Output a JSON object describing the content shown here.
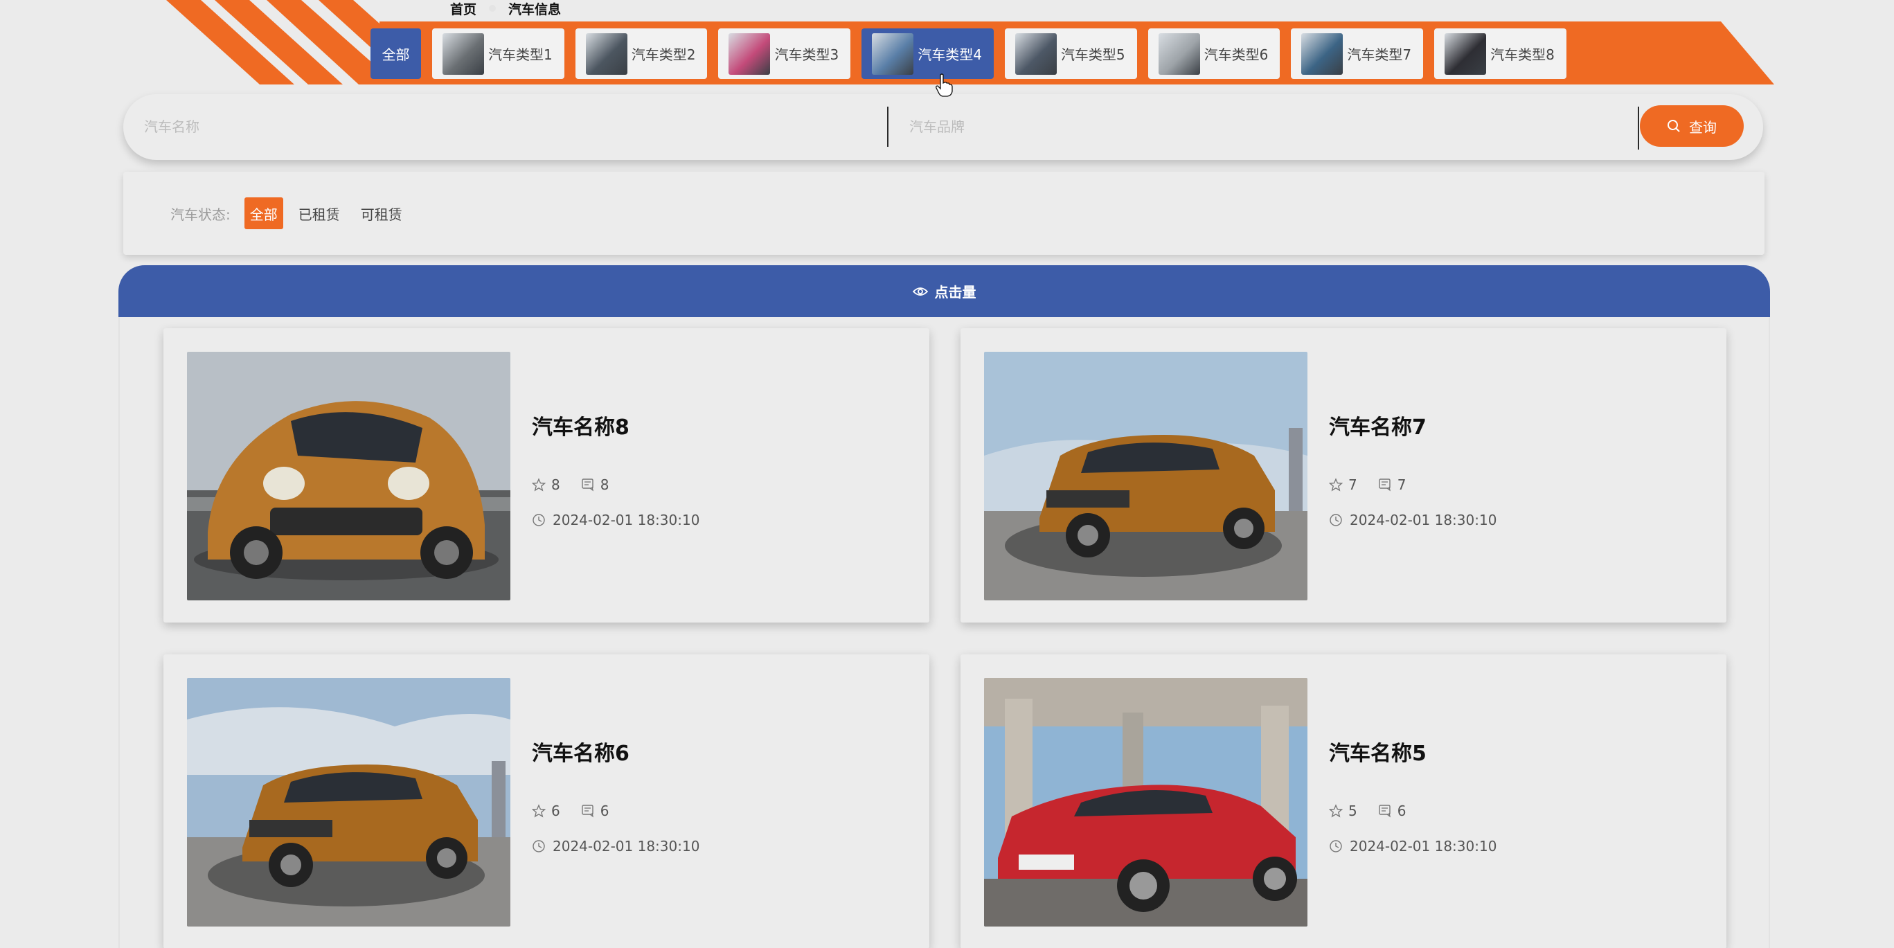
{
  "breadcrumb": {
    "home": "首页",
    "current": "汽车信息"
  },
  "categories": {
    "all_label": "全部",
    "items": [
      {
        "label": "汽车类型1",
        "color": "#6a6f73"
      },
      {
        "label": "汽车类型2",
        "color": "#4c5660"
      },
      {
        "label": "汽车类型3",
        "color": "#c44b7a"
      },
      {
        "label": "汽车类型4",
        "color": "#5a7fa8"
      },
      {
        "label": "汽车类型5",
        "color": "#4d5866"
      },
      {
        "label": "汽车类型6",
        "color": "#9da3a8"
      },
      {
        "label": "汽车类型7",
        "color": "#3c6485"
      },
      {
        "label": "汽车类型8",
        "color": "#2e2e34"
      }
    ],
    "active_index": 3
  },
  "search": {
    "name_placeholder": "汽车名称",
    "brand_placeholder": "汽车品牌",
    "button_label": "查询"
  },
  "filter": {
    "label": "汽车状态:",
    "options": [
      "全部",
      "已租赁",
      "可租赁"
    ],
    "active_index": 0
  },
  "click_bar": {
    "label": "点击量"
  },
  "cars": [
    {
      "name": "汽车名称8",
      "likes": "8",
      "comments": "8",
      "time": "2024-02-01 18:30:10",
      "body_color": "#b9782c",
      "sky": "#b8bfc6"
    },
    {
      "name": "汽车名称7",
      "likes": "7",
      "comments": "7",
      "time": "2024-02-01 18:30:10",
      "body_color": "#a8691f",
      "sky": "#a9c2d8"
    },
    {
      "name": "汽车名称6",
      "likes": "6",
      "comments": "6",
      "time": "2024-02-01 18:30:10",
      "body_color": "#a8691f",
      "sky": "#9fb9d2"
    },
    {
      "name": "汽车名称5",
      "likes": "5",
      "comments": "6",
      "time": "2024-02-01 18:30:10",
      "body_color": "#c6262e",
      "sky": "#8fb4d4"
    }
  ],
  "colors": {
    "accent": "#ef6a23",
    "primary": "#3d5ca8"
  }
}
